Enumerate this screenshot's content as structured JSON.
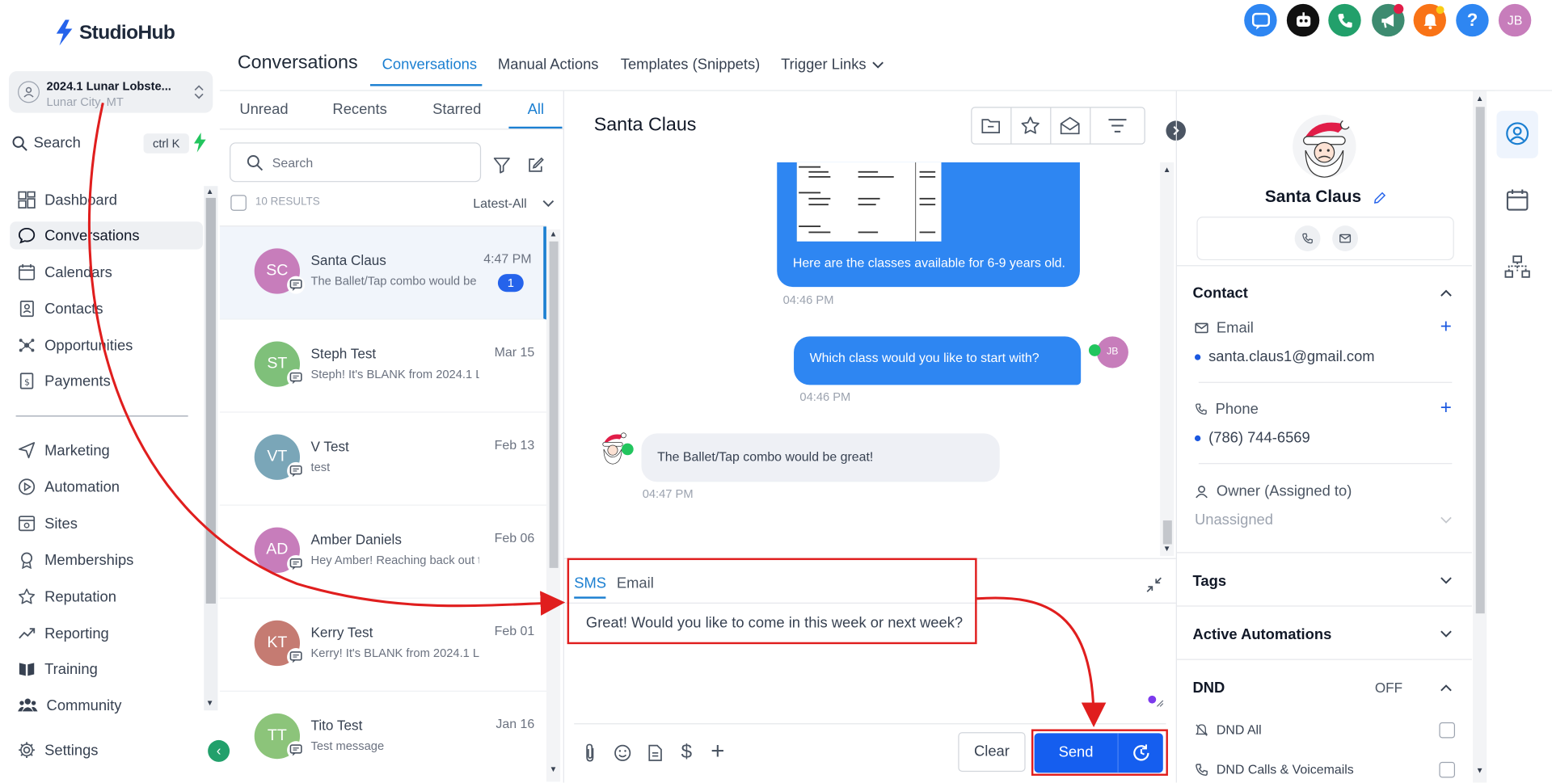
{
  "app": {
    "brand": "StudioHub"
  },
  "account": {
    "name": "2024.1 Lunar Lobste...",
    "location": "Lunar City, MT"
  },
  "sidebar": {
    "search_label": "Search",
    "search_shortcut": "ctrl K",
    "items": [
      {
        "label": "Dashboard",
        "icon": "dashboard-icon"
      },
      {
        "label": "Conversations",
        "icon": "chat-icon",
        "active": true
      },
      {
        "label": "Calendars",
        "icon": "calendar-icon"
      },
      {
        "label": "Contacts",
        "icon": "contacts-icon"
      },
      {
        "label": "Opportunities",
        "icon": "opportunities-icon"
      },
      {
        "label": "Payments",
        "icon": "payments-icon"
      },
      {
        "label": "Marketing",
        "icon": "send-icon"
      },
      {
        "label": "Automation",
        "icon": "automation-icon"
      },
      {
        "label": "Sites",
        "icon": "sites-icon"
      },
      {
        "label": "Memberships",
        "icon": "memberships-icon"
      },
      {
        "label": "Reputation",
        "icon": "star-icon"
      },
      {
        "label": "Reporting",
        "icon": "chart-icon"
      },
      {
        "label": "Training",
        "icon": "book-icon"
      },
      {
        "label": "Community",
        "icon": "people-icon"
      },
      {
        "label": "Settings",
        "icon": "gear-icon"
      }
    ]
  },
  "topbar": {
    "user_initials": "JB"
  },
  "header": {
    "title": "Conversations",
    "tabs": [
      "Conversations",
      "Manual Actions",
      "Templates (Snippets)",
      "Trigger Links"
    ]
  },
  "list": {
    "tabs": [
      "Unread",
      "Recents",
      "Starred",
      "All"
    ],
    "search_placeholder": "Search",
    "results": "10 RESULTS",
    "sort": "Latest-All",
    "rows": [
      {
        "initials": "SC",
        "name": "Santa Claus",
        "preview": "The Ballet/Tap combo would be",
        "time": "4:47 PM",
        "count": "1",
        "color": "#c77dbb"
      },
      {
        "initials": "ST",
        "name": "Steph Test",
        "preview": "Steph! It's BLANK from 2024.1 L",
        "time": "Mar 15",
        "color": "#7fc07a"
      },
      {
        "initials": "VT",
        "name": "V Test",
        "preview": "test",
        "time": "Feb 13",
        "color": "#7aa6b8"
      },
      {
        "initials": "AD",
        "name": "Amber Daniels",
        "preview": "Hey Amber! Reaching back out t",
        "time": "Feb 06",
        "color": "#c77dbb"
      },
      {
        "initials": "KT",
        "name": "Kerry Test",
        "preview": "Kerry! It's BLANK from 2024.1 Lu",
        "time": "Feb 01",
        "color": "#c57b72"
      },
      {
        "initials": "TT",
        "name": "Tito Test",
        "preview": "Test message",
        "time": "Jan 16",
        "color": "#8cc47a"
      }
    ]
  },
  "chat": {
    "contact": "Santa Claus",
    "messages": {
      "m1_text": "Here are the classes available for 6-9 years old.",
      "m1_time": "04:46 PM",
      "m2_text": "Which class would you like to start with?",
      "m2_time": "04:46 PM",
      "m2_avatar": "JB",
      "m3_text": "The Ballet/Tap combo would be great!",
      "m3_time": "04:47 PM"
    },
    "composer": {
      "tabs": [
        "SMS",
        "Email"
      ],
      "text": "Great! Would you like to come in this week or next week?",
      "clear": "Clear",
      "send": "Send"
    }
  },
  "contact_panel": {
    "name": "Santa Claus",
    "section_contact": "Contact",
    "email_label": "Email",
    "email": "santa.claus1@gmail.com",
    "phone_label": "Phone",
    "phone": "(786) 744-6569",
    "owner_label": "Owner (Assigned to)",
    "owner_value": "Unassigned",
    "tags": "Tags",
    "automations": "Active Automations",
    "dnd": "DND",
    "dnd_state": "OFF",
    "dnd_all": "DND All",
    "dnd_calls": "DND Calls & Voicemails"
  },
  "colors": {
    "accent": "#1b7fd1",
    "send": "#155eef",
    "annotation": "#e01e1e"
  }
}
